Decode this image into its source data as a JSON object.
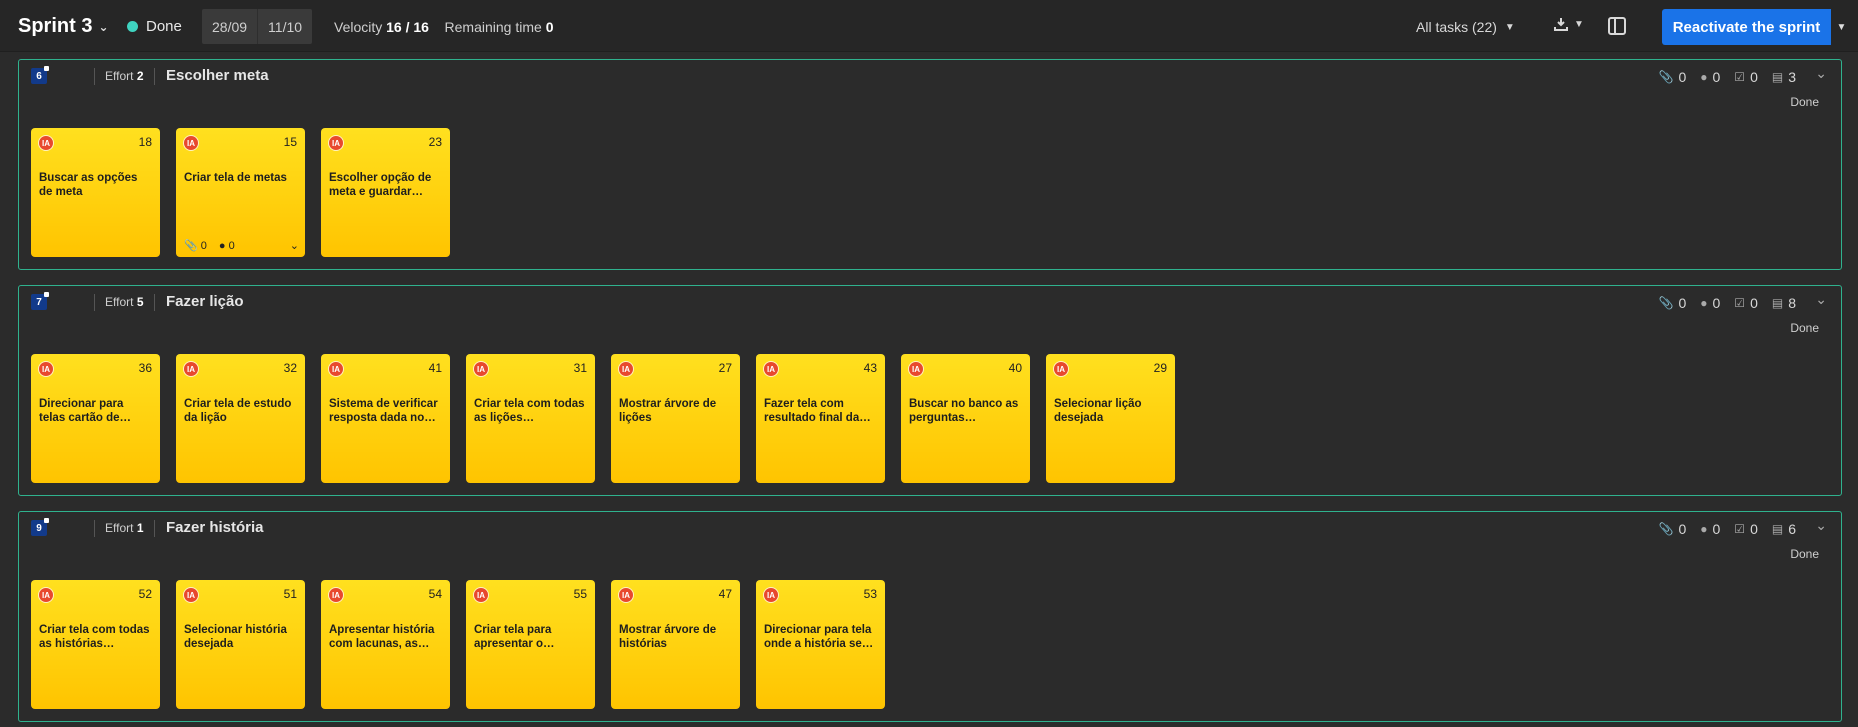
{
  "header": {
    "sprint_title": "Sprint 3",
    "status": "Done",
    "status_color": "#3fd3c0",
    "start_date": "28/09",
    "end_date": "11/10",
    "velocity_label": "Velocity",
    "velocity_value": "16 / 16",
    "remaining_label": "Remaining time",
    "remaining_value": "0",
    "all_tasks": "All tasks (22)",
    "reactivate_label": "Reactivate the sprint",
    "accent_color": "#1a73e8"
  },
  "stories": [
    {
      "number": "6",
      "effort_label": "Effort",
      "effort": "2",
      "title": "Escolher meta",
      "attachments": "0",
      "comments": "0",
      "checks": "0",
      "tasks": "3",
      "status": "Done",
      "cards": [
        {
          "avatar": "IA",
          "number": "18",
          "text": "Buscar as opções de meta"
        },
        {
          "avatar": "IA",
          "number": "15",
          "text": "Criar tela de metas",
          "attachments": "0",
          "comments": "0"
        },
        {
          "avatar": "IA",
          "number": "23",
          "text": "Escolher opção de meta e guardar…"
        }
      ]
    },
    {
      "number": "7",
      "effort_label": "Effort",
      "effort": "5",
      "title": "Fazer lição",
      "attachments": "0",
      "comments": "0",
      "checks": "0",
      "tasks": "8",
      "status": "Done",
      "cards": [
        {
          "avatar": "IA",
          "number": "36",
          "text": "Direcionar para telas cartão de…"
        },
        {
          "avatar": "IA",
          "number": "32",
          "text": "Criar tela de estudo da lição"
        },
        {
          "avatar": "IA",
          "number": "41",
          "text": "Sistema de verificar resposta dada no…"
        },
        {
          "avatar": "IA",
          "number": "31",
          "text": "Criar tela com todas as lições…"
        },
        {
          "avatar": "IA",
          "number": "27",
          "text": "Mostrar árvore de lições"
        },
        {
          "avatar": "IA",
          "number": "43",
          "text": "Fazer tela com resultado final da…"
        },
        {
          "avatar": "IA",
          "number": "40",
          "text": "Buscar no banco as perguntas…"
        },
        {
          "avatar": "IA",
          "number": "29",
          "text": "Selecionar lição desejada"
        }
      ]
    },
    {
      "number": "9",
      "effort_label": "Effort",
      "effort": "1",
      "title": "Fazer história",
      "attachments": "0",
      "comments": "0",
      "checks": "0",
      "tasks": "6",
      "status": "Done",
      "cards": [
        {
          "avatar": "IA",
          "number": "52",
          "text": "Criar tela com todas as histórias…"
        },
        {
          "avatar": "IA",
          "number": "51",
          "text": "Selecionar história desejada"
        },
        {
          "avatar": "IA",
          "number": "54",
          "text": "Apresentar história com lacunas, as…"
        },
        {
          "avatar": "IA",
          "number": "55",
          "text": "Criar tela para apresentar o…"
        },
        {
          "avatar": "IA",
          "number": "47",
          "text": "Mostrar árvore de histórias"
        },
        {
          "avatar": "IA",
          "number": "53",
          "text": "Direcionar para tela onde a história se…"
        }
      ]
    }
  ]
}
